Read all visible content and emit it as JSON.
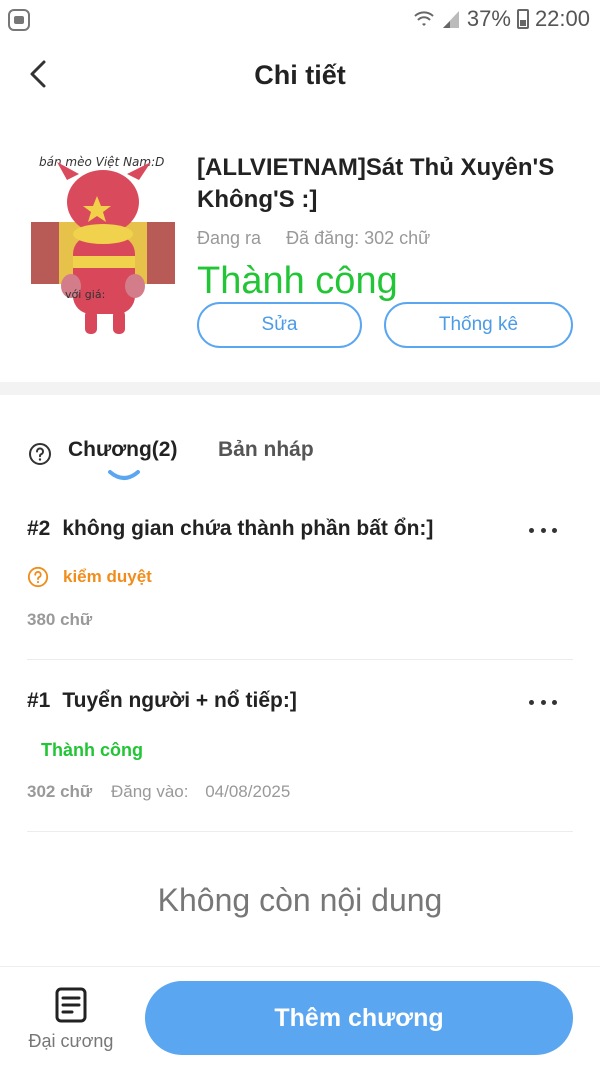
{
  "status_bar": {
    "battery": "37%",
    "time": "22:00"
  },
  "header": {
    "title": "Chi tiết"
  },
  "story": {
    "cover_caption_top": "bán mèo Việt Nam:D",
    "cover_caption_bottom": "với giá:",
    "title": "[ALLVIETNAM]Sát Thủ Xuyên'S Không'S :]",
    "state": "Đang ra",
    "posted_words": "Đã đăng: 302 chữ",
    "banner": "Thành công",
    "edit_label": "Sửa",
    "stats_label": "Thống kê"
  },
  "tabs": {
    "chapters_label": "Chương(2)",
    "drafts_label": "Bản nháp"
  },
  "chapters": [
    {
      "number": "#2",
      "title": "không gian chứa thành phần bất ổn:]",
      "status": "kiểm duyệt",
      "words": "380 chữ"
    },
    {
      "number": "#1",
      "title": "Tuyển người + nổ tiếp:]",
      "status": "Thành công",
      "words": "302 chữ",
      "posted_label": "Đăng vào:",
      "date": "04/08/2025"
    }
  ],
  "empty_message": "Không còn nội dung",
  "bottom_bar": {
    "outline_label": "Đại cương",
    "add_chapter_label": "Thêm chương"
  },
  "colors": {
    "accent_blue": "#5aa6f0",
    "success_green": "#22c535",
    "review_orange": "#f08d1c"
  }
}
